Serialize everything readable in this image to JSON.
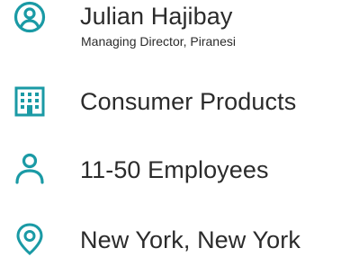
{
  "accent_color": "#1a9aa5",
  "contact": {
    "name": "Julian Hajibay",
    "title": "Managing Director, Piranesi",
    "icon": "account-circle-icon"
  },
  "industry": {
    "label": "Consumer Products",
    "icon": "building-icon"
  },
  "company_size": {
    "label": "11-50 Employees",
    "icon": "person-icon"
  },
  "location": {
    "label": "New York, New York",
    "icon": "location-pin-icon"
  }
}
